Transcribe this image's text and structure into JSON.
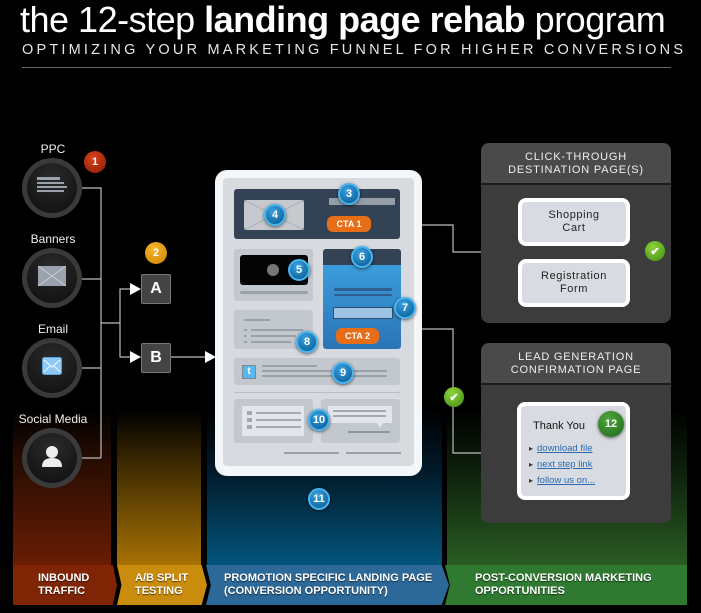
{
  "header": {
    "title_prefix": "the 12-step ",
    "title_bold": "landing page rehab",
    "title_suffix": " program",
    "subtitle": "OPTIMIZING YOUR MARKETING FUNNEL FOR HIGHER CONVERSIONS"
  },
  "sources": [
    {
      "label": "PPC",
      "icon": "text-ad-icon"
    },
    {
      "label": "Banners",
      "icon": "image-placeholder-icon"
    },
    {
      "label": "Email",
      "icon": "envelope-icon"
    },
    {
      "label": "Social Media",
      "icon": "person-icon"
    }
  ],
  "ab_test": {
    "a": "A",
    "b": "B"
  },
  "steps": [
    "1",
    "2",
    "3",
    "4",
    "5",
    "6",
    "7",
    "8",
    "9",
    "10",
    "11",
    "12"
  ],
  "landing_page": {
    "cta1": "CTA 1",
    "cta2": "CTA 2"
  },
  "click_through": {
    "title_line1": "CLICK-THROUGH",
    "title_line2": "DESTINATION PAGE(S)",
    "shopping_line1": "Shopping",
    "shopping_line2": "Cart",
    "registration_line1": "Registration",
    "registration_line2": "Form"
  },
  "lead_gen": {
    "title_line1": "LEAD GENERATION",
    "title_line2": "CONFIRMATION PAGE",
    "thank_you": "Thank You",
    "links": [
      "download file",
      "next step link",
      "follow us on..."
    ]
  },
  "columns": [
    {
      "line1": "INBOUND",
      "line2": "TRAFFIC",
      "color": "#7f2505"
    },
    {
      "line1": "A/B SPLIT",
      "line2": "TESTING",
      "color": "#c98c0c"
    },
    {
      "line1": "PROMOTION SPECIFIC LANDING PAGE",
      "line2": "(CONVERSION OPPORTUNITY)",
      "color": "#2c6898"
    },
    {
      "line1": "POST-CONVERSION MARKETING",
      "line2": "OPPORTUNITIES",
      "color": "#2f7a30"
    }
  ],
  "colors": {
    "badge_red": "#b22e0e",
    "badge_orange": "#e9a215",
    "badge_blue": "#0a6aa8",
    "badge_green": "#2e7f26",
    "cta_orange": "#e66e16",
    "check_green": "#5cb025"
  }
}
